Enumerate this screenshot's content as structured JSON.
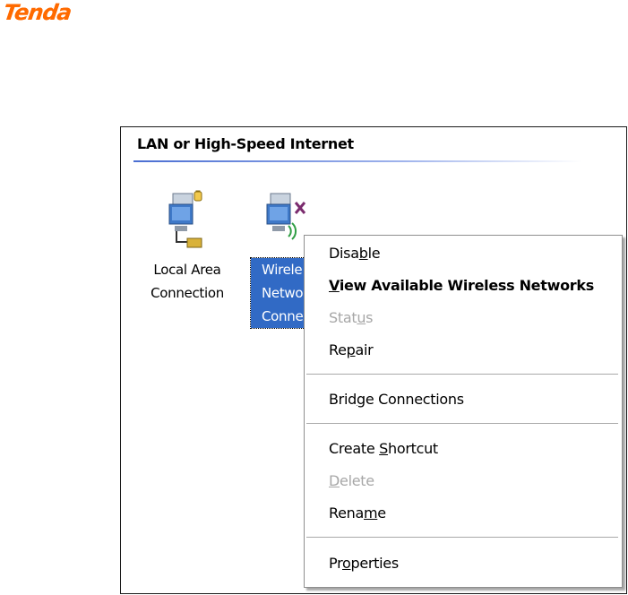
{
  "brand": {
    "logo_text": "Tenda",
    "color": "#ff6a00"
  },
  "group": {
    "title": "LAN or High-Speed Internet"
  },
  "connections": [
    {
      "label": "Local Area\nConnection",
      "icon": "lan-connection-icon",
      "selected": false
    },
    {
      "label": "Wirele\nNetwo\nConnec",
      "icon": "wireless-connection-icon",
      "selected": true
    }
  ],
  "context_menu": {
    "items": [
      {
        "pre": "Disa",
        "key": "b",
        "post": "le",
        "bold": false,
        "disabled": false
      },
      {
        "pre": "",
        "key": "V",
        "post": "iew Available Wireless Networks",
        "bold": true,
        "disabled": false
      },
      {
        "pre": "Stat",
        "key": "u",
        "post": "s",
        "bold": false,
        "disabled": true
      },
      {
        "pre": "Re",
        "key": "p",
        "post": "air",
        "bold": false,
        "disabled": false
      },
      {
        "pre": "Brid",
        "key": "g",
        "post": "e Connections",
        "bold": false,
        "disabled": false
      },
      {
        "pre": "Create ",
        "key": "S",
        "post": "hortcut",
        "bold": false,
        "disabled": false
      },
      {
        "pre": "",
        "key": "D",
        "post": "elete",
        "bold": false,
        "disabled": true
      },
      {
        "pre": "Rena",
        "key": "m",
        "post": "e",
        "bold": false,
        "disabled": false
      },
      {
        "pre": "Pr",
        "key": "o",
        "post": "perties",
        "bold": false,
        "disabled": false
      }
    ]
  },
  "colors": {
    "selection": "#316ac5",
    "menu_disabled": "#a7a7a7"
  }
}
